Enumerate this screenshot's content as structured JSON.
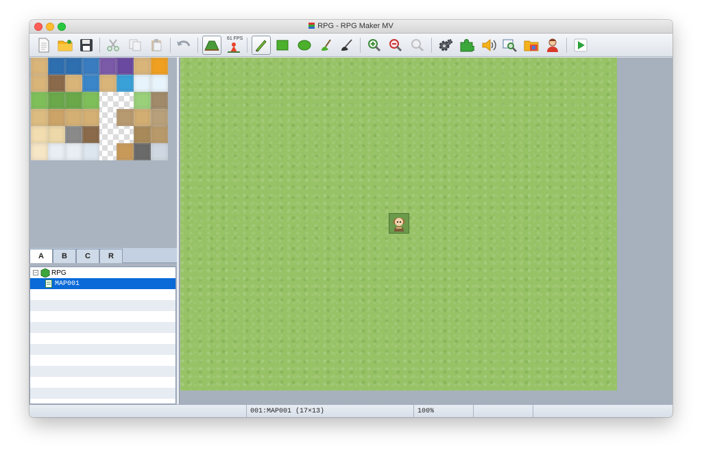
{
  "window": {
    "title": "RPG - RPG Maker MV",
    "title_icon": "app-icon"
  },
  "toolbar": {
    "buttons": [
      {
        "name": "new-project",
        "icon": "document-icon"
      },
      {
        "name": "open-project",
        "icon": "folder-icon"
      },
      {
        "name": "save-project",
        "icon": "floppy-icon"
      },
      {
        "name": "cut",
        "icon": "scissors-icon"
      },
      {
        "name": "copy",
        "icon": "copy-icon"
      },
      {
        "name": "paste",
        "icon": "clipboard-icon"
      },
      {
        "name": "undo",
        "icon": "undo-icon"
      },
      {
        "name": "map-mode",
        "icon": "map-mode-icon"
      },
      {
        "name": "event-mode",
        "icon": "event-mode-icon"
      },
      {
        "name": "pencil",
        "icon": "pencil-icon"
      },
      {
        "name": "rectangle",
        "icon": "rectangle-icon"
      },
      {
        "name": "ellipse",
        "icon": "ellipse-icon"
      },
      {
        "name": "fill",
        "icon": "fill-icon"
      },
      {
        "name": "shadow-pen",
        "icon": "shadow-pen-icon"
      },
      {
        "name": "zoom-in",
        "icon": "zoom-in-icon"
      },
      {
        "name": "zoom-out",
        "icon": "zoom-out-icon"
      },
      {
        "name": "zoom-actual",
        "icon": "zoom-actual-icon"
      },
      {
        "name": "database",
        "icon": "gear-icon"
      },
      {
        "name": "plugin-manager",
        "icon": "puzzle-icon"
      },
      {
        "name": "sound-test",
        "icon": "speaker-icon"
      },
      {
        "name": "event-searcher",
        "icon": "search-icon"
      },
      {
        "name": "resource-manager",
        "icon": "resource-icon"
      },
      {
        "name": "character-generator",
        "icon": "character-icon"
      },
      {
        "name": "playtest",
        "icon": "play-icon"
      }
    ],
    "fps_label": "61 FPS"
  },
  "palette": {
    "tabs": [
      "A",
      "B",
      "C",
      "R"
    ],
    "selected_tab": "A"
  },
  "map_tree": {
    "project": "RPG",
    "maps": [
      "MAP001"
    ],
    "selected_map": "MAP001"
  },
  "statusbar": {
    "map_info": "001:MAP001 (17×13)",
    "zoom": "100%"
  },
  "colors": {
    "accent": "#0a6ad8",
    "grass": "#97c266",
    "panel": "#aab4c0"
  }
}
